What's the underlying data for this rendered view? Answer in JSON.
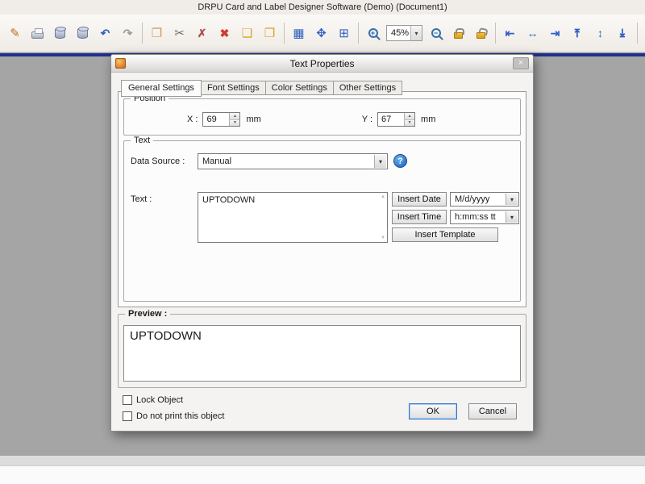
{
  "window": {
    "title": "DRPU Card and Label Designer Software (Demo) (Document1)"
  },
  "glyphs": {
    "dropdown": "▾",
    "arrow_up": "▲",
    "arrow_down": "▼"
  },
  "toolbar": {
    "zoom": {
      "value": "45%"
    },
    "icons": [
      {
        "name": "edit-document-icon",
        "glyph": "✎"
      },
      {
        "name": "print-icon",
        "glyph": ""
      },
      {
        "name": "database-export-icon",
        "glyph": ""
      },
      {
        "name": "database-icon",
        "glyph": ""
      },
      {
        "name": "undo-icon",
        "glyph": "↶"
      },
      {
        "name": "redo-icon",
        "glyph": "↷"
      },
      {
        "name": "copy-icon",
        "glyph": "❐"
      },
      {
        "name": "cut-icon",
        "glyph": "✂"
      },
      {
        "name": "delete-object-icon",
        "glyph": "✗"
      },
      {
        "name": "delete-icon",
        "glyph": "✖"
      },
      {
        "name": "paste-icon",
        "glyph": "❏"
      },
      {
        "name": "paste-special-icon",
        "glyph": "❐"
      },
      {
        "name": "grid-icon",
        "glyph": "▦"
      },
      {
        "name": "move-icon",
        "glyph": "✥"
      },
      {
        "name": "grid-settings-icon",
        "glyph": "⊞"
      },
      {
        "name": "zoom-in-icon",
        "glyph": ""
      },
      {
        "name": "zoom-out-icon",
        "glyph": ""
      },
      {
        "name": "lock-icon",
        "glyph": ""
      },
      {
        "name": "unlock-icon",
        "glyph": ""
      },
      {
        "name": "align-left-icon",
        "glyph": "⇤"
      },
      {
        "name": "align-center-horizontal-icon",
        "glyph": "↔"
      },
      {
        "name": "align-right-icon",
        "glyph": "⇥"
      },
      {
        "name": "align-top-icon",
        "glyph": "⇤"
      },
      {
        "name": "align-middle-vertical-icon",
        "glyph": "↕"
      },
      {
        "name": "align-bottom-icon",
        "glyph": "⇥"
      },
      {
        "name": "currency-icon",
        "glyph": "$"
      }
    ]
  },
  "dialog": {
    "title": "Text Properties",
    "close": "×",
    "tabs": [
      {
        "label": "General Settings",
        "active": true
      },
      {
        "label": "Font Settings",
        "active": false
      },
      {
        "label": "Color Settings",
        "active": false
      },
      {
        "label": "Other Settings",
        "active": false
      }
    ],
    "position": {
      "label": "Position",
      "x_label": "X :",
      "x_value": "69",
      "x_unit": "mm",
      "y_label": "Y :",
      "y_value": "67",
      "y_unit": "mm"
    },
    "text": {
      "label": "Text",
      "data_source_label": "Data Source :",
      "data_source_value": "Manual",
      "help": "?",
      "text_label": "Text :",
      "text_value": "UPTODOWN",
      "insert_date": "Insert Date",
      "date_format": "M/d/yyyy",
      "insert_time": "Insert Time",
      "time_format": "h:mm:ss tt",
      "insert_template": "Insert Template"
    },
    "preview": {
      "label": "Preview :",
      "value": "UPTODOWN"
    },
    "options": {
      "lock": "Lock Object",
      "no_print": "Do not print this object"
    },
    "buttons": {
      "ok": "OK",
      "cancel": "Cancel"
    }
  }
}
